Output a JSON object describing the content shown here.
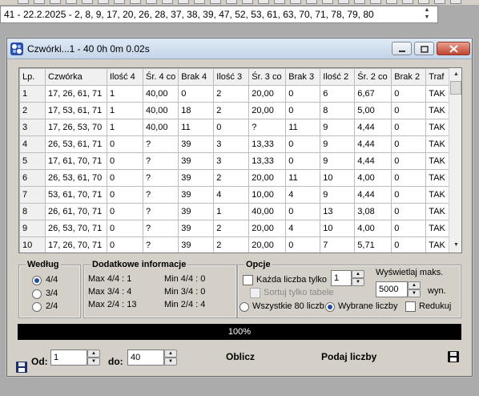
{
  "combo": {
    "value": "41 - 22.2.2025 - 2, 8, 9, 17, 20, 26, 28, 37, 38, 39, 47, 52, 53, 61, 63, 70, 71, 78, 79, 80"
  },
  "window": {
    "title": "Czwórki...1 - 40   0h 0m 0.02s"
  },
  "table": {
    "headers": [
      "Lp.",
      "Czwórka",
      "Ilość 4",
      "Śr. 4 co",
      "Brak 4",
      "Ilość 3",
      "Śr. 3 co",
      "Brak 3",
      "Ilość 2",
      "Śr. 2 co",
      "Brak 2",
      "Traf"
    ],
    "rows": [
      [
        "1",
        "17, 26, 61, 71",
        "1",
        "40,00",
        "0",
        "2",
        "20,00",
        "0",
        "6",
        "6,67",
        "0",
        "TAK"
      ],
      [
        "2",
        "17, 53, 61, 71",
        "1",
        "40,00",
        "18",
        "2",
        "20,00",
        "0",
        "8",
        "5,00",
        "0",
        "TAK"
      ],
      [
        "3",
        "17, 26, 53, 70",
        "1",
        "40,00",
        "11",
        "0",
        "?",
        "11",
        "9",
        "4,44",
        "0",
        "TAK"
      ],
      [
        "4",
        "26, 53, 61, 71",
        "0",
        "?",
        "39",
        "3",
        "13,33",
        "0",
        "9",
        "4,44",
        "0",
        "TAK"
      ],
      [
        "5",
        "17, 61, 70, 71",
        "0",
        "?",
        "39",
        "3",
        "13,33",
        "0",
        "9",
        "4,44",
        "0",
        "TAK"
      ],
      [
        "6",
        "26, 53, 61, 70",
        "0",
        "?",
        "39",
        "2",
        "20,00",
        "11",
        "10",
        "4,00",
        "0",
        "TAK"
      ],
      [
        "7",
        "53, 61, 70, 71",
        "0",
        "?",
        "39",
        "4",
        "10,00",
        "4",
        "9",
        "4,44",
        "0",
        "TAK"
      ],
      [
        "8",
        "26, 61, 70, 71",
        "0",
        "?",
        "39",
        "1",
        "40,00",
        "0",
        "13",
        "3,08",
        "0",
        "TAK"
      ],
      [
        "9",
        "26, 53, 70, 71",
        "0",
        "?",
        "39",
        "2",
        "20,00",
        "4",
        "10",
        "4,00",
        "0",
        "TAK"
      ],
      [
        "10",
        "17, 26, 70, 71",
        "0",
        "?",
        "39",
        "2",
        "20,00",
        "0",
        "7",
        "5,71",
        "0",
        "TAK"
      ]
    ]
  },
  "wedlug": {
    "label": "Według",
    "options": [
      "4/4",
      "3/4",
      "2/4"
    ],
    "selected": "4/4"
  },
  "dodatkowe": {
    "label": "Dodatkowe informacje",
    "max44": "Max 4/4 : 1",
    "min44": "Min 4/4 :  0",
    "max34": "Max 3/4 : 4",
    "min34": "Min 3/4 :  0",
    "max24": "Max 2/4 : 13",
    "min24": "Min 2/4 :  4"
  },
  "opcje": {
    "label": "Opcje",
    "kazda_label": "Każda liczba tylko",
    "kazda_value": "1",
    "sortuj_label": "Sortuj tylko tabele",
    "wyswietlaj_label": "Wyświetlaj maks.",
    "wyswietlaj_value": "5000",
    "wyn_label": "wyn.",
    "wszystkie_label": "Wszystkie 80 liczb",
    "wybrane_label": "Wybrane liczby",
    "redukuj_label": "Redukuj"
  },
  "progress": {
    "text": "100%",
    "value": 1.0
  },
  "bottom": {
    "od_label": "Od:",
    "od_value": "1",
    "do_label": "do:",
    "do_value": "40",
    "oblicz_label": "Oblicz",
    "podaj_label": "Podaj liczby"
  }
}
